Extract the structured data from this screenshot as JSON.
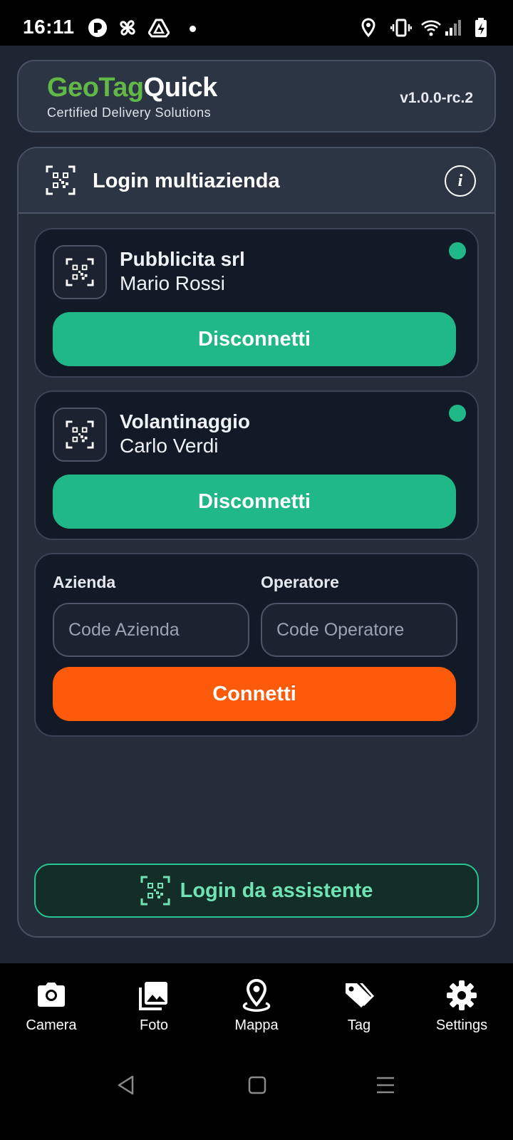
{
  "status_bar": {
    "time": "16:11",
    "icons": [
      "circle-r-icon",
      "fan-icon",
      "drive-icon",
      "dot-icon",
      "location-icon",
      "vibrate-icon",
      "wifi-icon",
      "signal-icon",
      "battery-charging-icon"
    ]
  },
  "header": {
    "brand_part1": "GeoTag",
    "brand_part2": "Quick",
    "tagline": "Certified Delivery Solutions",
    "version": "v1.0.0-rc.2",
    "brand_colors": {
      "geo_tag": "#62b846",
      "quick": "#ffffff"
    }
  },
  "panel": {
    "icon": "qr-code-icon",
    "title": "Login multiazienda",
    "info_icon": "info-icon"
  },
  "sessions": [
    {
      "company": "Pubblicita srl",
      "operator": "Mario Rossi",
      "status_color": "#1fb886",
      "button_label": "Disconnetti"
    },
    {
      "company": "Volantinaggio",
      "operator": "Carlo Verdi",
      "status_color": "#1fb886",
      "button_label": "Disconnetti"
    }
  ],
  "form": {
    "company_label": "Azienda",
    "company_placeholder": "Code Azienda",
    "operator_label": "Operatore",
    "operator_placeholder": "Code Operatore",
    "connect_label": "Connetti"
  },
  "assistant_button": {
    "label": "Login da assistente",
    "icon": "qr-code-icon"
  },
  "bottom_nav": [
    {
      "label": "Camera",
      "icon": "camera-icon"
    },
    {
      "label": "Foto",
      "icon": "photo-library-icon"
    },
    {
      "label": "Mappa",
      "icon": "map-pin-icon"
    },
    {
      "label": "Tag",
      "icon": "tag-icon"
    },
    {
      "label": "Settings",
      "icon": "gear-icon"
    }
  ],
  "colors": {
    "accent_green": "#1fb886",
    "accent_orange": "#fb5a0a",
    "background": "#1e2533"
  }
}
